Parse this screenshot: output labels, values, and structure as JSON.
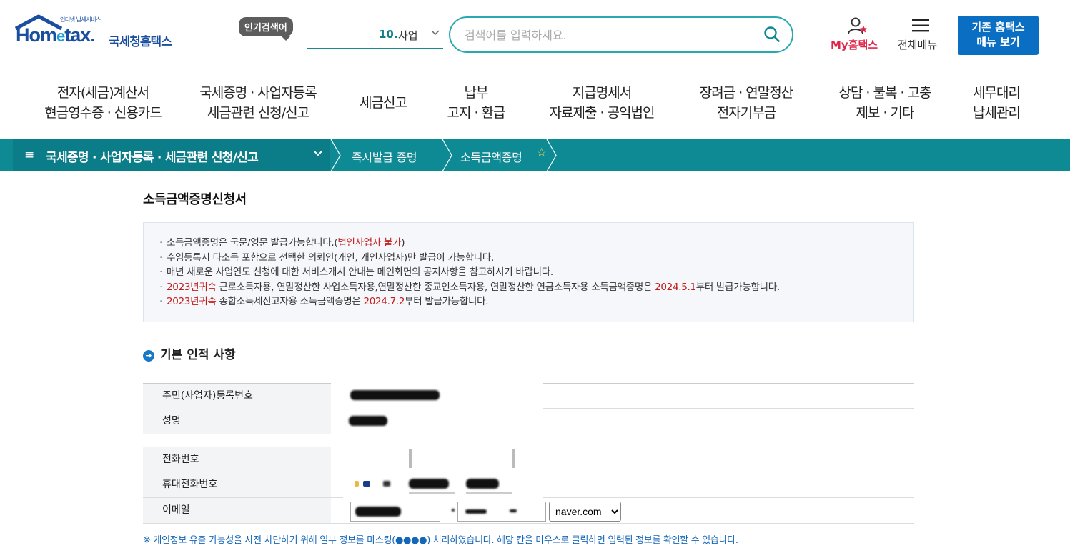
{
  "header": {
    "logo_tagline": "인터넷 납세서비스",
    "logo_home": "Hom",
    "logo_e": "e",
    "logo_tax": "tax.",
    "logo_korean": "국세청홈택스",
    "popular_badge": "인기검색어",
    "popular_keyword_num": "10.",
    "popular_keyword": "사업",
    "search_placeholder": "검색어를 입력하세요.",
    "my_hometax": "My홈택스",
    "all_menu": "전체메뉴",
    "legacy_line1": "기존 홈택스",
    "legacy_line2": "메뉴 보기"
  },
  "gnb": [
    {
      "line1": "전자(세금)계산서",
      "line2": "현금영수증 · 신용카드"
    },
    {
      "line1": "국세증명 · 사업자등록",
      "line2": "세금관련 신청/신고"
    },
    {
      "line1": "세금신고",
      "line2": ""
    },
    {
      "line1": "납부",
      "line2": "고지 · 환급"
    },
    {
      "line1": "지급명세서",
      "line2": "자료제출 · 공익법인"
    },
    {
      "line1": "장려금 · 연말정산",
      "line2": "전자기부금"
    },
    {
      "line1": "상담 · 불복 · 고충",
      "line2": "제보 · 기타"
    },
    {
      "line1": "세무대리",
      "line2": "납세관리"
    }
  ],
  "breadcrumb": {
    "root": "국세증명 · 사업자등록 · 세금관련 신청/신고",
    "level2": "즉시발급 증명",
    "level3": "소득금액증명"
  },
  "page_title": "소득금액증명신청서",
  "notice": {
    "line1_a": "소득금액증명은 국문/영문 발급가능합니다.(",
    "line1_red": "법인사업자 불가",
    "line1_b": ")",
    "line2": "수임등록시 타소득 포함으로 선택한 의뢰인(개인, 개인사업자)만 발급이 가능합니다.",
    "line3": "매년 새로운 사업연도 신청에 대한 서비스개시 안내는 메인화면의 공지사항을 참고하시기 바랍니다.",
    "line4_red1": "2023년귀속",
    "line4_a": " 근로소득자용, 연말정산한 사업소득자용,연말정산한 종교인소득자용, 연말정산한 연금소득자용 소득금액증명은 ",
    "line4_red2": "2024.5.1",
    "line4_b": "부터 발급가능합니다.",
    "line5_red1": "2023년귀속",
    "line5_a": " 종합소득세신고자용 소득금액증명은 ",
    "line5_red2": "2024.7.2",
    "line5_b": "부터 발급가능합니다."
  },
  "section_title": "기본 인적 사항",
  "form": {
    "rrn_label": "주민(사업자)등록번호",
    "name_label": "성명",
    "phone_label": "전화번호",
    "mobile_label": "휴대전화번호",
    "email_label": "이메일",
    "email_domain": "naver.com",
    "email_options": [
      "naver.com"
    ]
  },
  "footnote": "※ 개인정보 유출 가능성을 사전 차단하기 위해 일부 정보를 마스킹(●●●●) 처리하였습니다. 해당 칸을 마우스로 클릭하면 입력된 정보를 확인할 수 있습니다.",
  "colors": {
    "teal": "#0e8a95",
    "brand_blue": "#1a4fa0",
    "legacy_btn": "#0a6fc2",
    "red": "#c41a1a",
    "my_pink": "#e0254b"
  }
}
